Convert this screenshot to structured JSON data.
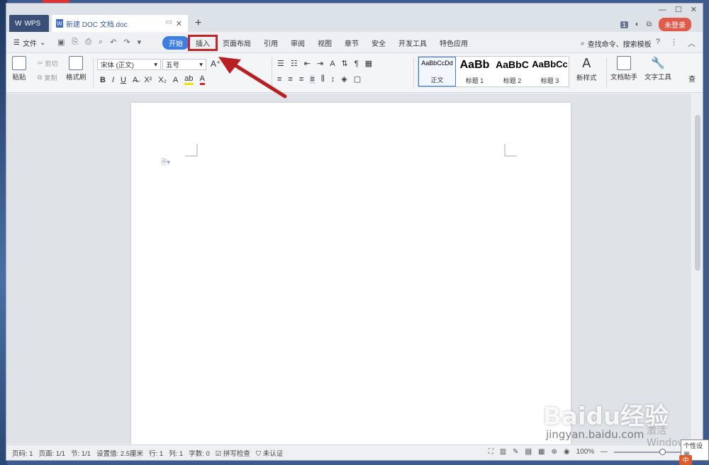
{
  "titlebar": {
    "app_tab": "WPS",
    "doc_tab": "新建 DOC 文档.doc",
    "new_tab": "+",
    "page_count_badge": "1",
    "login_label": "未登录"
  },
  "menubar": {
    "file_label": "文件",
    "start_label": "开始",
    "items": [
      "插入",
      "页面布局",
      "引用",
      "审阅",
      "视图",
      "章节",
      "安全",
      "开发工具",
      "特色应用"
    ],
    "highlighted_item": "插入",
    "search_label": "查找命令、搜索模板",
    "help_label": "?"
  },
  "ribbon": {
    "paste_label": "粘贴",
    "cut_label": "剪切",
    "copy_label": "复制",
    "format_painter_label": "格式刷",
    "font_name": "宋体 (正文)",
    "font_size": "五号",
    "styles": [
      {
        "sample": "AaBbCcDd",
        "label": "正文"
      },
      {
        "sample": "AaBb",
        "label": "标题 1"
      },
      {
        "sample": "AaBbC",
        "label": "标题 2"
      },
      {
        "sample": "AaBbCc",
        "label": "标题 3"
      }
    ],
    "new_style_label": "新样式",
    "doc_helper_label": "文档助手",
    "text_tools_label": "文字工具",
    "find_label": "查"
  },
  "statusbar": {
    "page_no": "页码: 1",
    "pages": "页面: 1/1",
    "section": "节: 1/1",
    "setting": "设置值: 2.5厘米",
    "row": "行: 1",
    "col": "列: 1",
    "words": "字数: 0",
    "spellcheck": "拼写检查",
    "auth": "未认证",
    "zoom": "100%",
    "zoom_level": 0.68
  },
  "overlay": {
    "watermark_brand": "Baidu经验",
    "watermark_url": "jingyan.baidu.com",
    "windows_text": "激活 Windows",
    "tooltip": "个性设置"
  },
  "colors": {
    "accent": "#3d7ee0",
    "highlight_box": "#c0252a",
    "arrow": "#b81e22",
    "login": "#e05b4a"
  }
}
